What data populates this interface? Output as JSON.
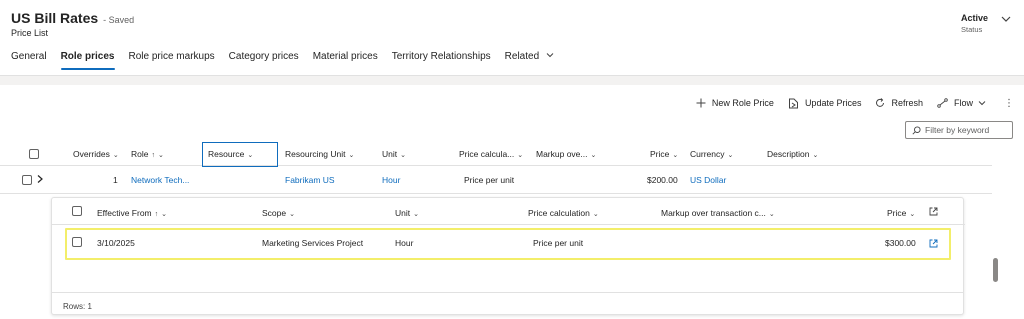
{
  "header": {
    "title": "US Bill Rates",
    "saved": "- Saved",
    "subtitle": "Price List",
    "status_value": "Active",
    "status_label": "Status"
  },
  "tabs": [
    {
      "label": "General"
    },
    {
      "label": "Role prices",
      "active": true
    },
    {
      "label": "Role price markups"
    },
    {
      "label": "Category prices"
    },
    {
      "label": "Material prices"
    },
    {
      "label": "Territory Relationships"
    },
    {
      "label": "Related"
    }
  ],
  "commands": {
    "new_role_price": "New Role Price",
    "update_prices": "Update Prices",
    "refresh": "Refresh",
    "flow": "Flow",
    "more": "⋮"
  },
  "search": {
    "placeholder": "Filter by keyword"
  },
  "grid": {
    "columns": {
      "overrides": "Overrides",
      "role": "Role",
      "resource": "Resource",
      "resourcing_unit": "Resourcing Unit",
      "unit": "Unit",
      "price_calc": "Price calcula...",
      "markup": "Markup ove...",
      "price": "Price",
      "currency": "Currency",
      "description": "Description"
    },
    "row": {
      "overrides": "1",
      "role": "Network Tech...",
      "resourcing_unit": "Fabrikam US",
      "unit": "Hour",
      "price_calc": "Price per unit",
      "price": "$200.00",
      "currency": "US Dollar"
    }
  },
  "subgrid": {
    "columns": {
      "effective_from": "Effective From",
      "scope": "Scope",
      "unit": "Unit",
      "price_calc": "Price calculation",
      "markup": "Markup over transaction c...",
      "price": "Price"
    },
    "row": {
      "effective_from": "3/10/2025",
      "scope": "Marketing Services Project",
      "unit": "Hour",
      "price_calc": "Price per unit",
      "price": "$300.00"
    },
    "rows_label": "Rows: 1"
  },
  "colors": {
    "accent": "#0f6cbd",
    "highlight": "#f3ee6a"
  }
}
